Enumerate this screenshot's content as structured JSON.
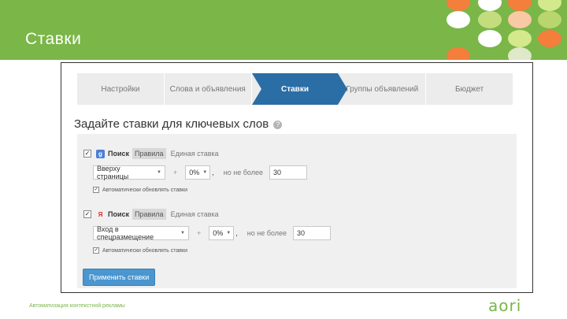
{
  "slide": {
    "title": "Ставки",
    "footer": "Автоматизация контекстной рекламы",
    "logo": "aori"
  },
  "wizard": {
    "steps": [
      "Настройки",
      "Слова и объявления",
      "Ставки",
      "Группы объявлений",
      "Бюджет"
    ],
    "active_index": 2
  },
  "heading": "Задайте ставки для ключевых слов",
  "engines": [
    {
      "icon": "google-icon",
      "checked": true,
      "search_label": "Поиск",
      "rule_tag": "Правила",
      "rule_text": "Единая ставка",
      "position_value": "Вверху страницы",
      "percent_value": "0%",
      "comma": ",",
      "limit_label": "но не более",
      "limit_value": "30",
      "auto_label": "Автоматически обновлять ставки",
      "auto_checked": true
    },
    {
      "icon": "yandex-icon",
      "checked": true,
      "search_label": "Поиск",
      "rule_tag": "Правила",
      "rule_text": "Единая ставка",
      "position_value": "Вход в спецразмещение",
      "percent_value": "0%",
      "comma": ",",
      "limit_label": "но не более",
      "limit_value": "30",
      "auto_label": "Автоматически обновлять ставки",
      "auto_checked": true
    }
  ],
  "plus_sign": "+",
  "apply_button": "Применить ставки",
  "colors": {
    "green": "#7ab648",
    "accent_blue": "#2b6ea6",
    "button_blue": "#4a96cf"
  }
}
